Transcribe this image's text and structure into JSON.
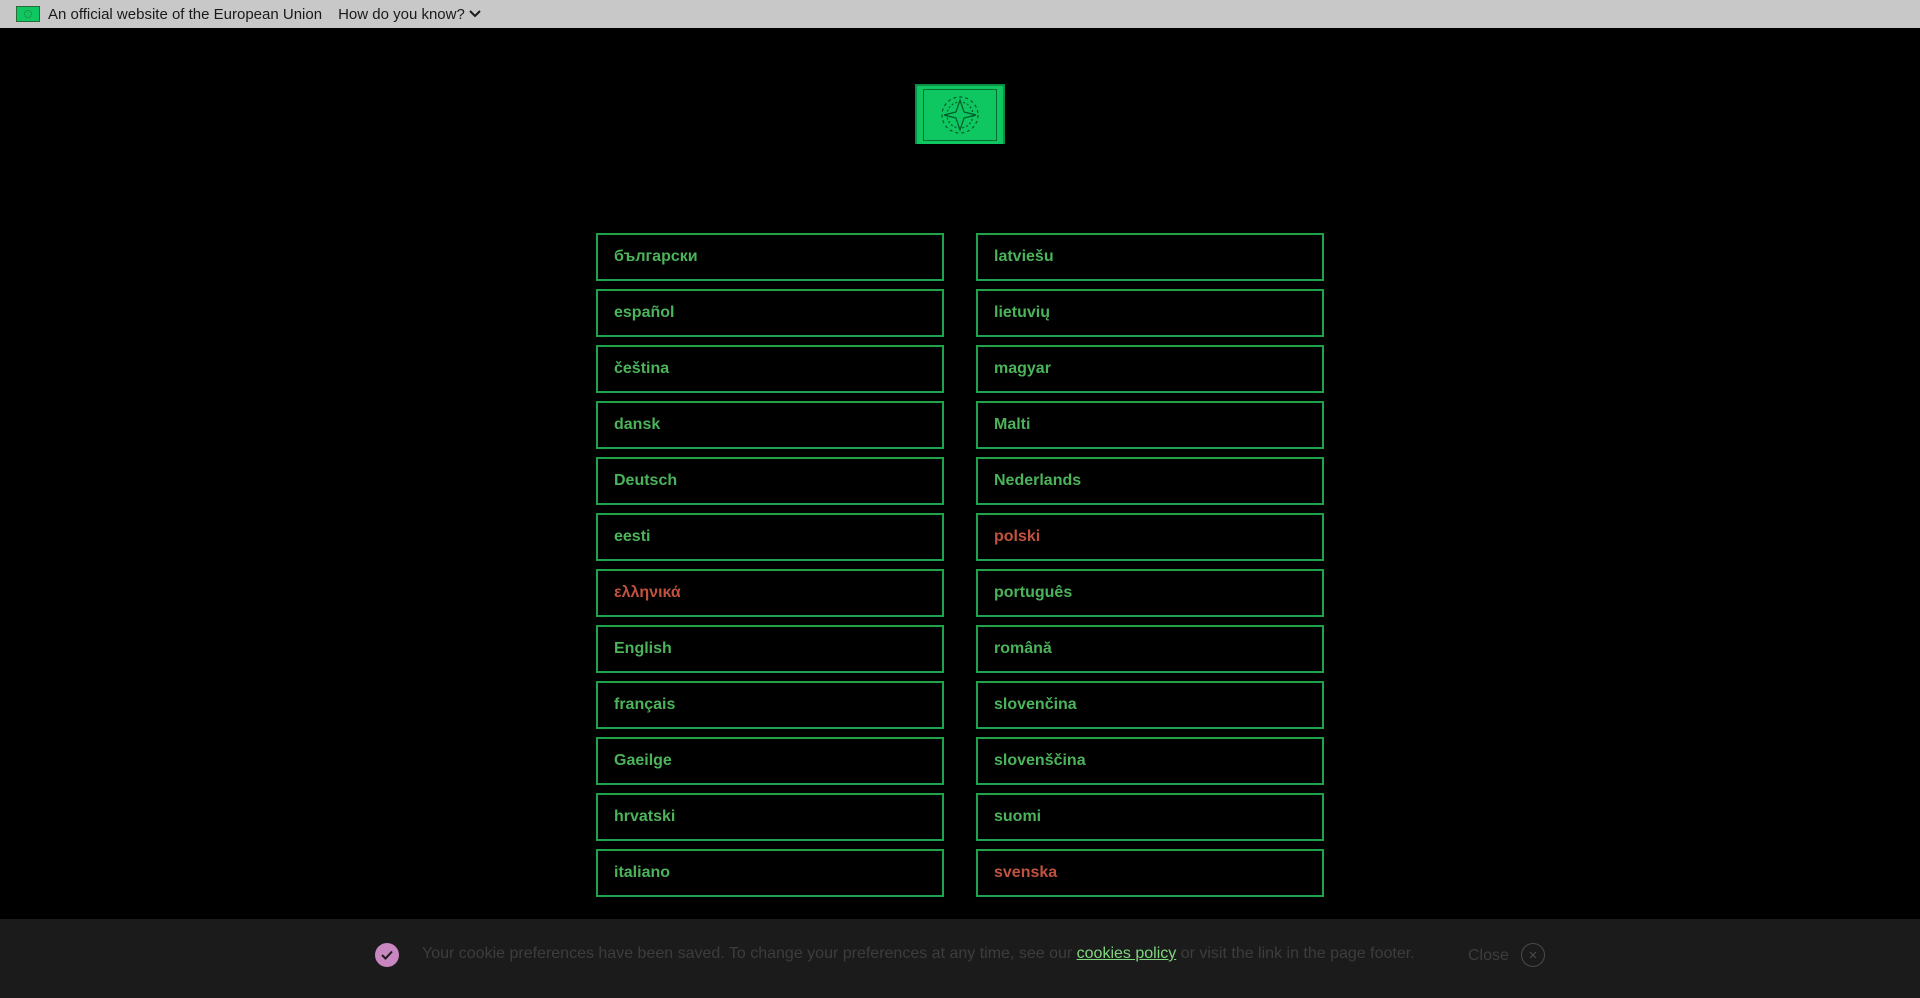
{
  "topbar": {
    "flag_icon": "eu-flag-icon",
    "official_text": "An official website of the European Union",
    "howknow_label": "How do you know?",
    "howknow_icon": "chevron-down-icon"
  },
  "logo": {
    "icon": "eu-logo-icon",
    "color": "#0fc760"
  },
  "languages": {
    "left": [
      "български",
      "español",
      "čeština",
      "dansk",
      "Deutsch",
      "eesti",
      "ελληνικά",
      "English",
      "français",
      "Gaeilge",
      "hrvatski",
      "italiano"
    ],
    "right": [
      "latviešu",
      "lietuvių",
      "magyar",
      "Malti",
      "Nederlands",
      "polski",
      "português",
      "română",
      "slovenčina",
      "slovenščina",
      "suomi",
      "svenska"
    ]
  },
  "cookie": {
    "check_icon": "check-icon",
    "text_before": "Your cookie preferences have been saved. To change your preferences at any time, see our ",
    "link_text": "cookies policy",
    "text_after": " or visit the link in the page footer.",
    "close_label": "Close",
    "close_icon": "close-icon"
  },
  "colors": {
    "accent_green": "#1fa34a",
    "label_green": "#4bb35a",
    "label_red": "#c0523f",
    "check_purple": "#c887c0"
  }
}
